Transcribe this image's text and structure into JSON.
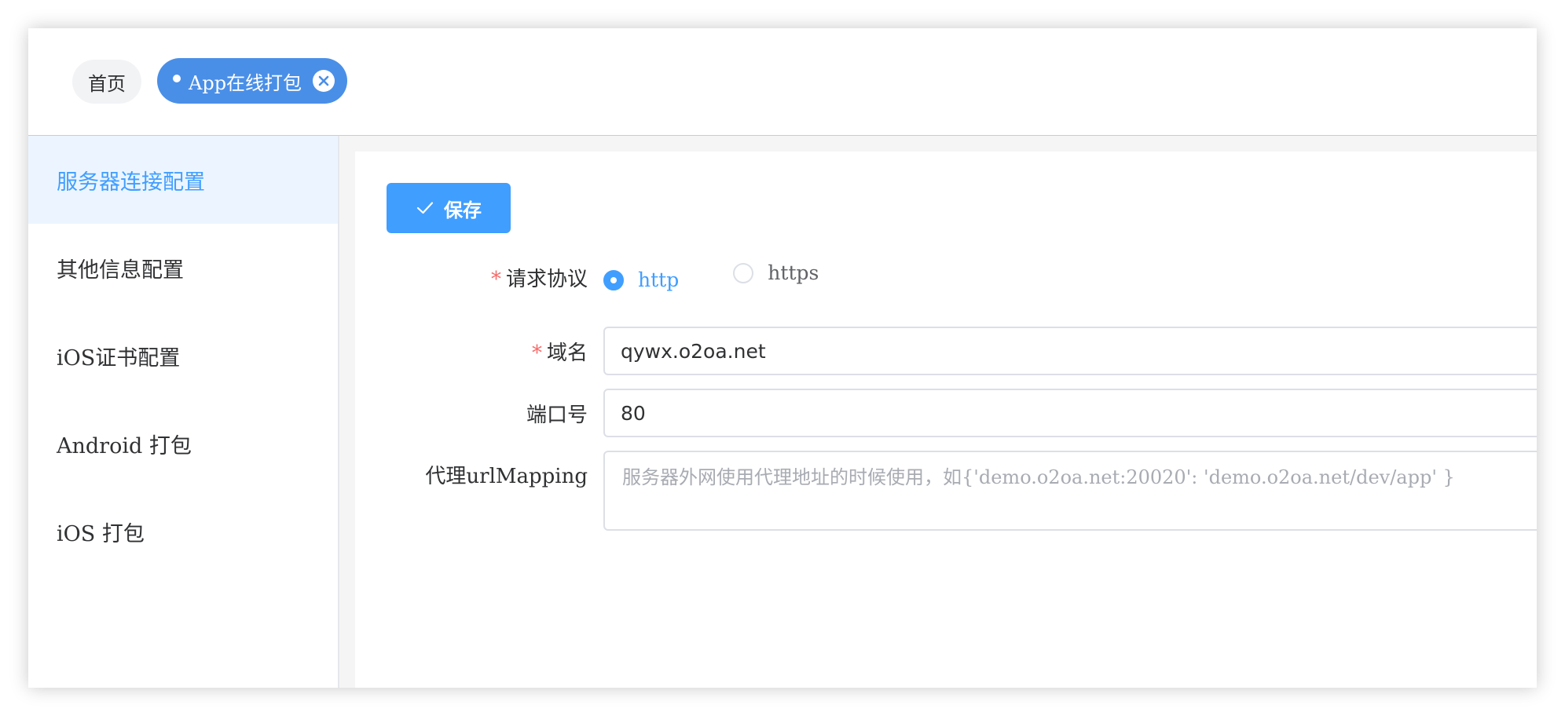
{
  "tabs": {
    "home": "首页",
    "active": "App在线打包"
  },
  "sidebar": {
    "items": [
      {
        "label": "服务器连接配置",
        "active": true
      },
      {
        "label": "其他信息配置",
        "active": false
      },
      {
        "label": "iOS证书配置",
        "active": false
      },
      {
        "label": "Android 打包",
        "active": false
      },
      {
        "label": "iOS 打包",
        "active": false
      }
    ]
  },
  "toolbar": {
    "save_label": "保存"
  },
  "form": {
    "protocol": {
      "label": "请求协议",
      "required": "*",
      "options": [
        "http",
        "https"
      ],
      "selected": "http"
    },
    "domain": {
      "label": "域名",
      "required": "*",
      "value": "qywx.o2oa.net"
    },
    "port": {
      "label": "端口号",
      "value": "80"
    },
    "proxy": {
      "label": "代理urlMapping",
      "placeholder": "服务器外网使用代理地址的时候使用，如{'demo.o2oa.net:20020': 'demo.o2oa.net/dev/app' }"
    }
  },
  "colors": {
    "accent": "#409eff",
    "tab_active": "#4a8fe7",
    "required": "#f56c6c",
    "sidebar_active_bg": "#ecf5ff"
  },
  "icons": {
    "save": "check-icon",
    "tab_close": "close-circle-icon"
  }
}
